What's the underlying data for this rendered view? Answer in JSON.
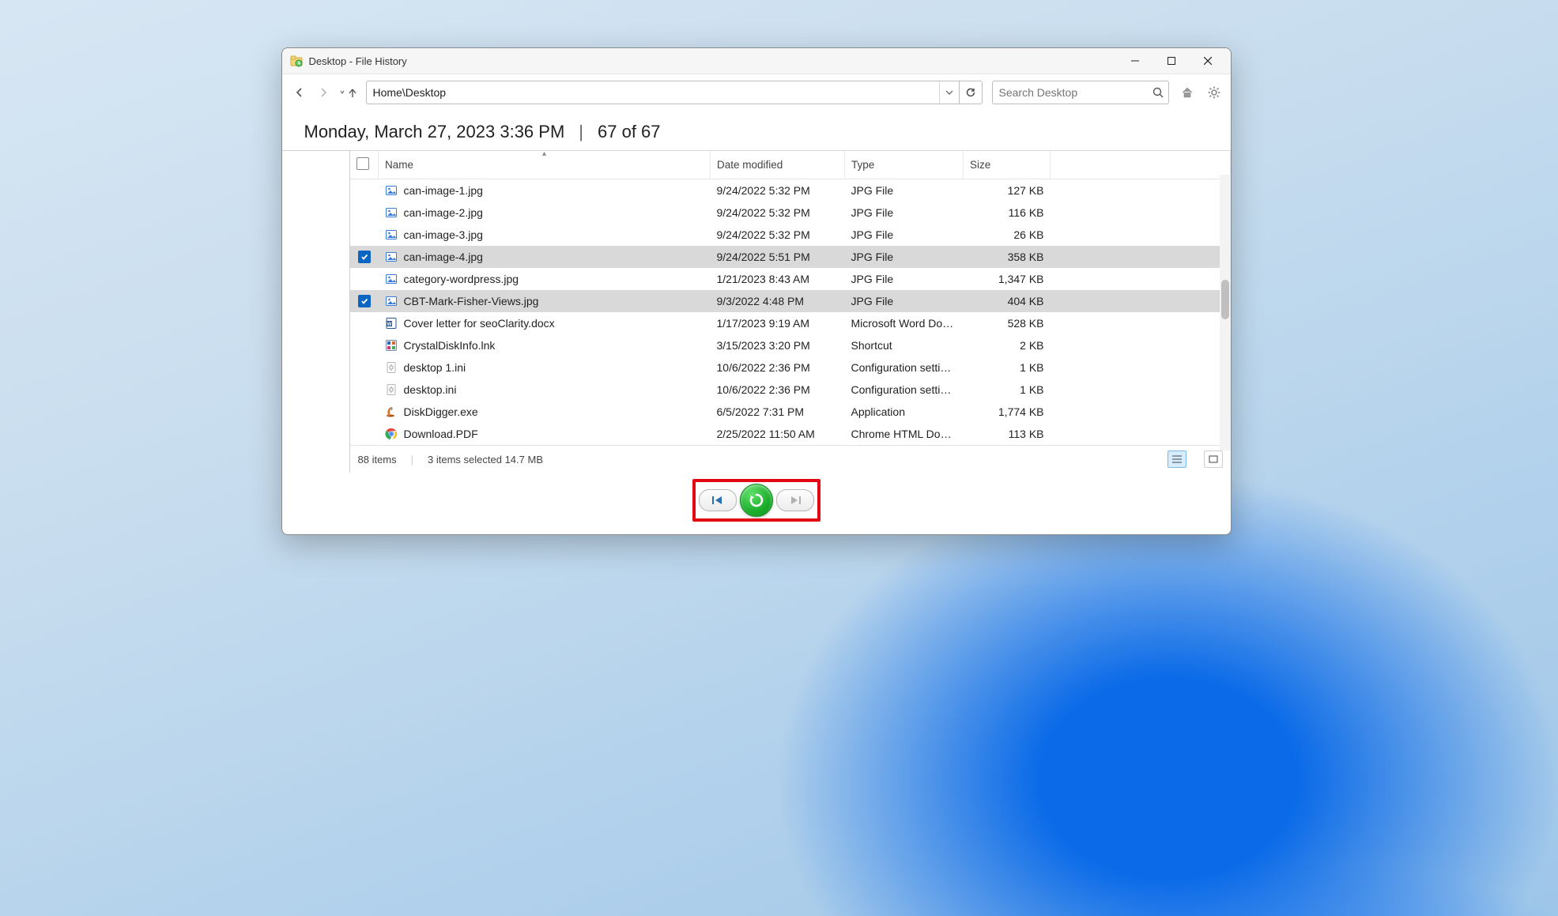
{
  "window": {
    "title": "Desktop - File History"
  },
  "toolbar": {
    "path": "Home\\Desktop",
    "search_placeholder": "Search Desktop"
  },
  "heading": {
    "timestamp": "Monday, March 27, 2023 3:36 PM",
    "position": "67 of 67"
  },
  "columns": {
    "name": "Name",
    "date": "Date modified",
    "type": "Type",
    "size": "Size"
  },
  "files": [
    {
      "selected": false,
      "icon": "image",
      "name": "can-image-1.jpg",
      "date": "9/24/2022 5:32 PM",
      "type": "JPG File",
      "size": "127 KB"
    },
    {
      "selected": false,
      "icon": "image",
      "name": "can-image-2.jpg",
      "date": "9/24/2022 5:32 PM",
      "type": "JPG File",
      "size": "116 KB"
    },
    {
      "selected": false,
      "icon": "image",
      "name": "can-image-3.jpg",
      "date": "9/24/2022 5:32 PM",
      "type": "JPG File",
      "size": "26 KB"
    },
    {
      "selected": true,
      "icon": "image",
      "name": "can-image-4.jpg",
      "date": "9/24/2022 5:51 PM",
      "type": "JPG File",
      "size": "358 KB"
    },
    {
      "selected": false,
      "icon": "image",
      "name": "category-wordpress.jpg",
      "date": "1/21/2023 8:43 AM",
      "type": "JPG File",
      "size": "1,347 KB"
    },
    {
      "selected": true,
      "icon": "image",
      "name": "CBT-Mark-Fisher-Views.jpg",
      "date": "9/3/2022 4:48 PM",
      "type": "JPG File",
      "size": "404 KB"
    },
    {
      "selected": false,
      "icon": "word",
      "name": "Cover letter for seoClarity.docx",
      "date": "1/17/2023 9:19 AM",
      "type": "Microsoft Word Doc...",
      "size": "528 KB"
    },
    {
      "selected": false,
      "icon": "shortcut",
      "name": "CrystalDiskInfo.lnk",
      "date": "3/15/2023 3:20 PM",
      "type": "Shortcut",
      "size": "2 KB"
    },
    {
      "selected": false,
      "icon": "ini",
      "name": "desktop 1.ini",
      "date": "10/6/2022 2:36 PM",
      "type": "Configuration settings",
      "size": "1 KB"
    },
    {
      "selected": false,
      "icon": "ini",
      "name": "desktop.ini",
      "date": "10/6/2022 2:36 PM",
      "type": "Configuration settings",
      "size": "1 KB"
    },
    {
      "selected": false,
      "icon": "exe",
      "name": "DiskDigger.exe",
      "date": "6/5/2022 7:31 PM",
      "type": "Application",
      "size": "1,774 KB"
    },
    {
      "selected": false,
      "icon": "chrome",
      "name": "Download.PDF",
      "date": "2/25/2022 11:50 AM",
      "type": "Chrome HTML Docu...",
      "size": "113 KB"
    }
  ],
  "status": {
    "count": "88 items",
    "selection": "3 items selected  14.7 MB"
  }
}
